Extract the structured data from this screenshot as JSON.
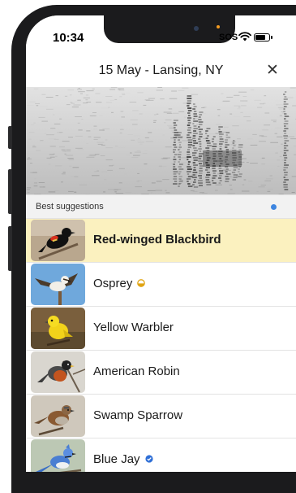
{
  "status": {
    "time": "10:34",
    "sos": "SOS"
  },
  "header": {
    "title": "15 May - Lansing, NY"
  },
  "suggestions": {
    "heading": "Best suggestions",
    "items": [
      {
        "name": "Red-winged Blackbird",
        "selected": true
      },
      {
        "name": "Osprey",
        "badge": "gold-badge-icon"
      },
      {
        "name": "Yellow Warbler"
      },
      {
        "name": "American Robin"
      },
      {
        "name": "Swamp Sparrow"
      },
      {
        "name": "Blue Jay",
        "badge": "verified-badge-icon"
      }
    ]
  },
  "colors": {
    "selected_row": "#fbf1bf",
    "indicator": "#3d85e0"
  }
}
